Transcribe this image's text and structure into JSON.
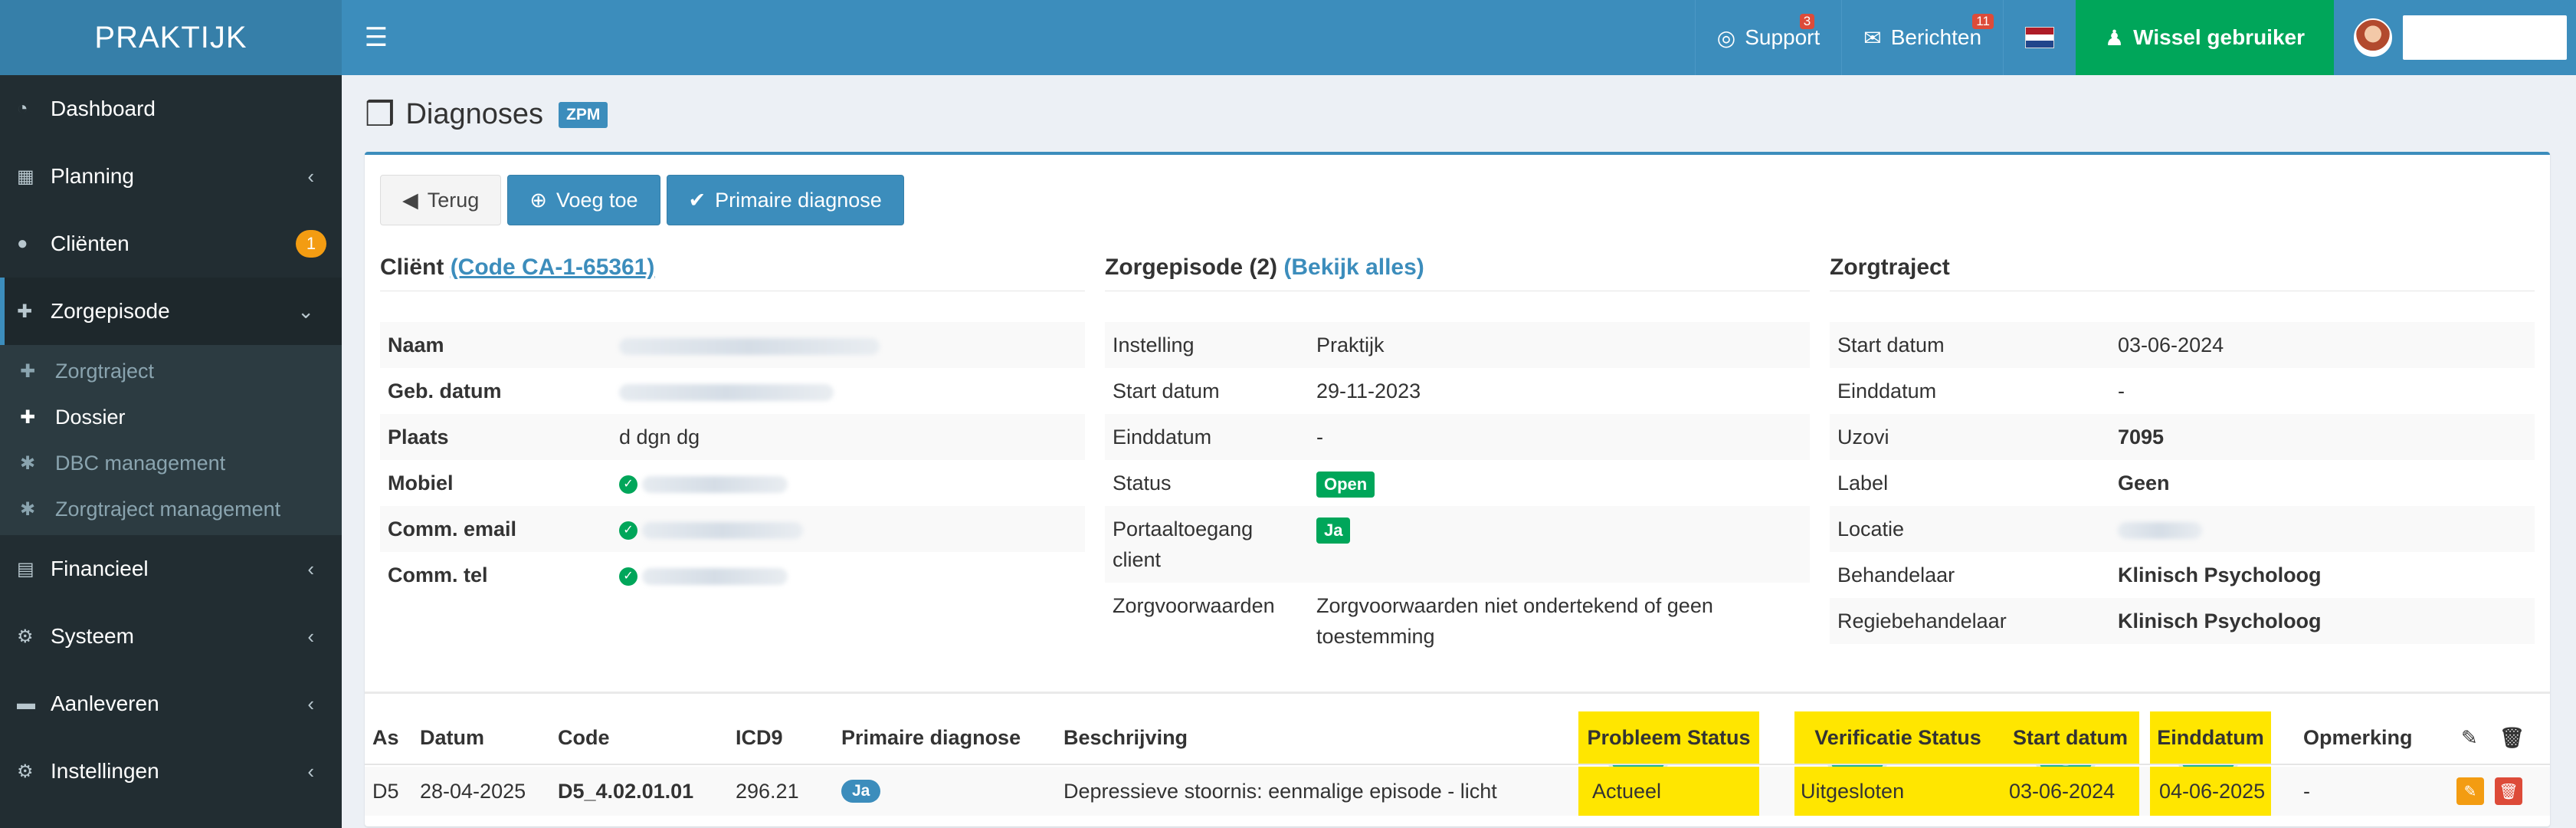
{
  "header": {
    "brand": "PRAKTIJK",
    "support_label": "Support",
    "support_badge": "3",
    "messages_label": "Berichten",
    "messages_badge": "11",
    "switch_user_label": "Wissel gebruiker",
    "flag_colors": [
      "#ae1c28",
      "#ffffff",
      "#21468b"
    ]
  },
  "sidebar": {
    "items": [
      {
        "label": "Dashboard",
        "icon": "dashboard-icon"
      },
      {
        "label": "Planning",
        "icon": "calendar-icon"
      },
      {
        "label": "Cliënten",
        "icon": "user-icon",
        "badge": "1"
      },
      {
        "label": "Zorgepisode",
        "icon": "medkit-icon"
      },
      {
        "label": "Financieel",
        "icon": "book-icon"
      },
      {
        "label": "Systeem",
        "icon": "cogs-icon"
      },
      {
        "label": "Aanleveren",
        "icon": "truck-icon"
      },
      {
        "label": "Instellingen",
        "icon": "gear-icon"
      }
    ],
    "submenu": [
      {
        "label": "Zorgtraject"
      },
      {
        "label": "Dossier"
      },
      {
        "label": "DBC management"
      },
      {
        "label": "Zorgtraject management"
      }
    ]
  },
  "page": {
    "title": "Diagnoses",
    "badge": "ZPM"
  },
  "buttons": {
    "back": "Terug",
    "add": "Voeg toe",
    "primary": "Primaire diagnose"
  },
  "client": {
    "title": "Cliënt",
    "code_link": "(Code CA-1-65361)",
    "rows": [
      {
        "key": "Naam"
      },
      {
        "key": "Geb. datum"
      },
      {
        "key": "Plaats",
        "value": "d dgn dg"
      },
      {
        "key": "Mobiel"
      },
      {
        "key": "Comm. email"
      },
      {
        "key": "Comm. tel"
      }
    ]
  },
  "episode": {
    "title": "Zorgepisode (2)",
    "link": "(Bekijk alles)",
    "rows": [
      {
        "key": "Instelling",
        "value": "Praktijk"
      },
      {
        "key": "Start datum",
        "value": "29-11-2023"
      },
      {
        "key": "Einddatum",
        "value": "-"
      },
      {
        "key": "Status",
        "value": "Open"
      },
      {
        "key": "Portaaltoegang client",
        "value": "Ja"
      },
      {
        "key": "Zorgvoorwaarden",
        "value": "Zorgvoorwaarden niet ondertekend of geen toestemming"
      }
    ]
  },
  "traject": {
    "title": "Zorgtraject",
    "rows": [
      {
        "key": "Start datum",
        "value": "03-06-2024"
      },
      {
        "key": "Einddatum",
        "value": "-"
      },
      {
        "key": "Uzovi",
        "value": "7095"
      },
      {
        "key": "Label",
        "value": "Geen"
      },
      {
        "key": "Locatie"
      },
      {
        "key": "Behandelaar",
        "value": "Klinisch Psycholoog"
      },
      {
        "key": "Regiebehandelaar",
        "value": "Klinisch Psycholoog"
      }
    ]
  },
  "table": {
    "headers": [
      "As",
      "Datum",
      "Code",
      "ICD9",
      "Primaire diagnose",
      "Beschrijving",
      "Probleem Status",
      "Verificatie Status",
      "Start datum",
      "Einddatum",
      "Opmerking"
    ],
    "row": [
      "D5",
      "28-04-2025",
      "D5_4.02.01.01",
      "296.21",
      "Ja",
      "Depressieve stoornis: eenmalige episode - licht",
      "Actueel",
      "Uitgesloten",
      "03-06-2024",
      "04-06-2025",
      "-"
    ],
    "highlight_color": "#ffe600"
  },
  "markers": [
    "1",
    "2",
    "3",
    "4"
  ]
}
